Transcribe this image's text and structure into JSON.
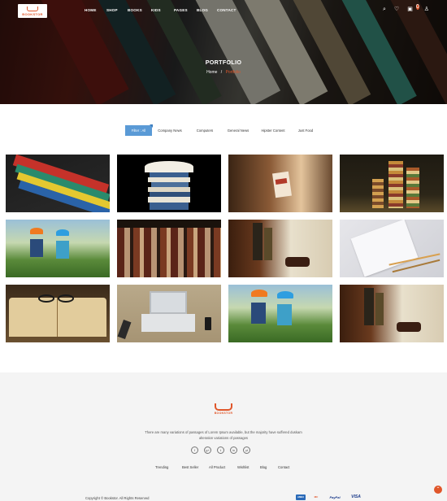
{
  "brand": {
    "logo_text": "BOOKSTOR"
  },
  "nav": {
    "items": [
      "HOME",
      "SHOP",
      "BOOKS",
      "KIDS",
      "PAGES",
      "BLOG",
      "CONTACT"
    ]
  },
  "header_icons": {
    "search": "search-icon",
    "wishlist": "heart-icon",
    "cart": "cart-icon",
    "account": "user-icon",
    "cart_count": "0"
  },
  "hero": {
    "title": "PORTFOLIO",
    "breadcrumb_home": "Home",
    "breadcrumb_sep": "/",
    "breadcrumb_current": "Portfolio"
  },
  "filters": [
    "Filter : All",
    "Company News",
    "Computers",
    "General News",
    "Hipster Content",
    "Just Food"
  ],
  "gallery": [
    "colorful books on shelf",
    "open book on stack",
    "hand picking book",
    "books and toy figures",
    "kids in hats reading",
    "old book spines",
    "shelf with toy car",
    "notebook and pencils",
    "open book with glasses",
    "laptop on desk",
    "kids in hats reading",
    "shelf with toy car"
  ],
  "footer": {
    "logo_text": "BOOKSTOR",
    "description": "There are many variations of passages of Lorem Ipsum available, but the majority have suffered duskam alteration variations of passages",
    "socials": [
      "f",
      "g+",
      "t",
      "in",
      "yt"
    ],
    "links": [
      "Trending",
      "Best Seller",
      "All Product",
      "Wishlist",
      "Blog",
      "Contact"
    ],
    "copyright": "Copyright © Bookstor. All Rights Reserved",
    "payments": [
      "AMEX",
      "MC",
      "PayPal",
      "VISA"
    ]
  },
  "colors": {
    "accent": "#e0562a",
    "filter_active": "#5a9ad6",
    "footer_bg": "#f4f4f4"
  }
}
